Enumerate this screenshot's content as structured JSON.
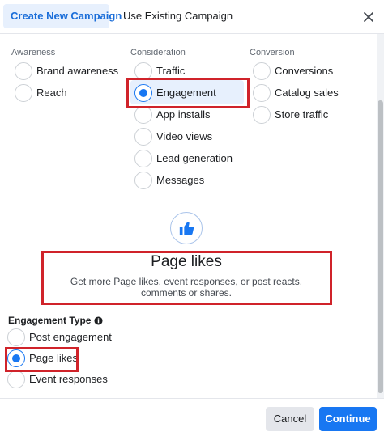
{
  "tabs": {
    "create_new": "Create New Campaign",
    "use_existing": "Use Existing Campaign"
  },
  "columns": {
    "awareness": {
      "label": "Awareness",
      "options": [
        "Brand awareness",
        "Reach"
      ]
    },
    "consideration": {
      "label": "Consideration",
      "options": [
        "Traffic",
        "Engagement",
        "App installs",
        "Video views",
        "Lead generation",
        "Messages"
      ]
    },
    "conversion": {
      "label": "Conversion",
      "options": [
        "Conversions",
        "Catalog sales",
        "Store traffic"
      ]
    }
  },
  "selected_objective": "Engagement",
  "detail": {
    "icon": "thumbs-up-icon",
    "title": "Page likes",
    "description": "Get more Page likes, event responses, or post reacts, comments or shares."
  },
  "engagement_type": {
    "label": "Engagement Type",
    "options": [
      "Post engagement",
      "Page likes",
      "Event responses"
    ],
    "selected": "Page likes"
  },
  "footer": {
    "cancel": "Cancel",
    "continue": "Continue"
  },
  "colors": {
    "accent": "#1877f2",
    "highlight": "#e7f0fd",
    "annotation_red": "#d0232a"
  }
}
